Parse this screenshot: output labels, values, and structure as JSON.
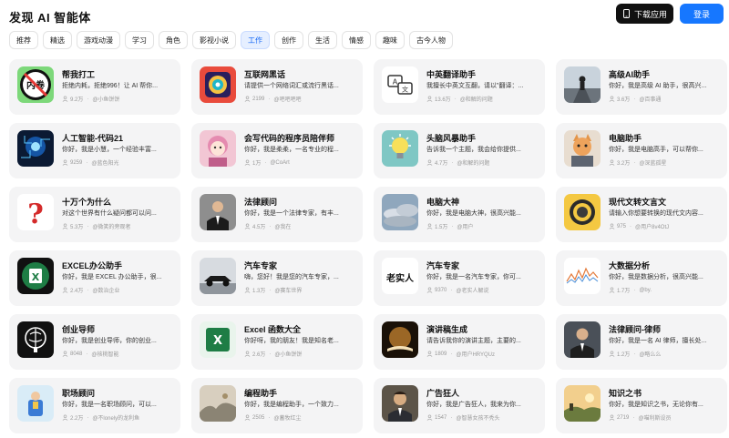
{
  "header": {
    "title": "发现 AI 智能体",
    "download_label": "下载应用",
    "login_label": "登录"
  },
  "tabs": [
    {
      "label": "推荐"
    },
    {
      "label": "精选"
    },
    {
      "label": "游戏动漫"
    },
    {
      "label": "学习"
    },
    {
      "label": "角色"
    },
    {
      "label": "影视小说"
    },
    {
      "label": "工作",
      "active": true
    },
    {
      "label": "创作"
    },
    {
      "label": "生活"
    },
    {
      "label": "情感"
    },
    {
      "label": "趣味"
    },
    {
      "label": "古今人物"
    }
  ],
  "cards": [
    {
      "title": "帮我打工",
      "desc": "拒绝内耗，拒绝996！让 AI 帮你...",
      "count": "9.2万",
      "author": "@小鱼饼饼",
      "thumb": "neijuan",
      "thumb_text": "内卷"
    },
    {
      "title": "互联网黑话",
      "desc": "请提供一个网络词汇或流行黑话...",
      "count": "2199",
      "author": "@吧吧吧吧",
      "thumb": "colorful"
    },
    {
      "title": "中英翻译助手",
      "desc": "我擅长中英文互翻，请以\"翻译：...",
      "count": "13.6万",
      "author": "@和解的问题",
      "thumb": "translate"
    },
    {
      "title": "高级AI助手",
      "desc": "你好，我是高级 AI 助手，很高兴...",
      "count": "3.6万",
      "author": "@百事通",
      "thumb": "road"
    },
    {
      "title": "人工智能-代码21",
      "desc": "你好，我是小慧，一个经验丰富...",
      "count": "9259",
      "author": "@蓝色阳光",
      "thumb": "circuit"
    },
    {
      "title": "会写代码的程序员陪伴师",
      "desc": "你好，我是柔柔，一名专业的程...",
      "count": "1万",
      "author": "@CoArt",
      "thumb": "anime"
    },
    {
      "title": "头脑风暴助手",
      "desc": "告诉我一个主题，我会给你提供...",
      "count": "4.7万",
      "author": "@和解的问题",
      "thumb": "bulb"
    },
    {
      "title": "电脑助手",
      "desc": "你好，我是电脑高手，可以帮你...",
      "count": "3.2万",
      "author": "@深蓝孤星",
      "thumb": "cat"
    },
    {
      "title": "十万个为什么",
      "desc": "对这个世界有什么疑问都可以问...",
      "count": "5.3万",
      "author": "@微笑的旁观者",
      "thumb": "question"
    },
    {
      "title": "法律顾问",
      "desc": "你好，我是一个法律专家，有丰...",
      "count": "4.5万",
      "author": "@我在",
      "thumb": "lawyer"
    },
    {
      "title": "电脑大神",
      "desc": "你好，我是电脑大神，很高兴能...",
      "count": "1.5万",
      "author": "@用户",
      "thumb": "clouds"
    },
    {
      "title": "现代文转文言文",
      "desc": "请输入你想要转换的现代文内容...",
      "count": "975",
      "author": "@用户8v4OtJ",
      "thumb": "medal"
    },
    {
      "title": "EXCEL办公助手",
      "desc": "你好，我是 EXCEL 办公助手，很...",
      "count": "2.4万",
      "author": "@数治企业",
      "thumb": "excel-dark"
    },
    {
      "title": "汽车专家",
      "desc": "嗨，您好！我是您的汽车专家，...",
      "count": "1.3万",
      "author": "@赛车世界",
      "thumb": "racecar"
    },
    {
      "title": "汽车专家",
      "desc": "你好，我是一名汽车专家，你可...",
      "count": "9370",
      "author": "@老实人解说",
      "thumb": "calligraphy",
      "thumb_text": "老实人"
    },
    {
      "title": "大数据分析",
      "desc": "你好，我是数据分析，很高兴能...",
      "count": "1.7万",
      "author": "@by.",
      "thumb": "chart"
    },
    {
      "title": "创业导师",
      "desc": "你好，我是创业导师，你的创业...",
      "count": "8048",
      "author": "@核桃智能",
      "thumb": "brain"
    },
    {
      "title": "Excel 函数大全",
      "desc": "你好呀，我的朋友！我是知名老...",
      "count": "2.6万",
      "author": "@小鱼饼饼",
      "thumb": "excel-light"
    },
    {
      "title": "演讲稿生成",
      "desc": "请告诉我你的演讲主题，主要的...",
      "count": "1809",
      "author": "@用户HRYQUz",
      "thumb": "book"
    },
    {
      "title": "法律顾问-律师",
      "desc": "你好，我是一名 AI 律师，擅长处...",
      "count": "1.2万",
      "author": "@略么么",
      "thumb": "suit"
    },
    {
      "title": "职场顾问",
      "desc": "你好，我是一名职场顾问，可以...",
      "count": "2.2万",
      "author": "@不lonely的龙利鱼",
      "thumb": "worker"
    },
    {
      "title": "编程助手",
      "desc": "你好，我是编程助手，一个致力...",
      "count": "2505",
      "author": "@蓄牧红尘",
      "thumb": "painting"
    },
    {
      "title": "广告狂人",
      "desc": "你好，我是广告狂人，我来为你...",
      "count": "1547",
      "author": "@智慧女孩不秃头",
      "thumb": "man"
    },
    {
      "title": "知识之书",
      "desc": "你好，我是知识之书，无论你有...",
      "count": "2719",
      "author": "@喵利斯设员",
      "thumb": "landscape"
    }
  ]
}
